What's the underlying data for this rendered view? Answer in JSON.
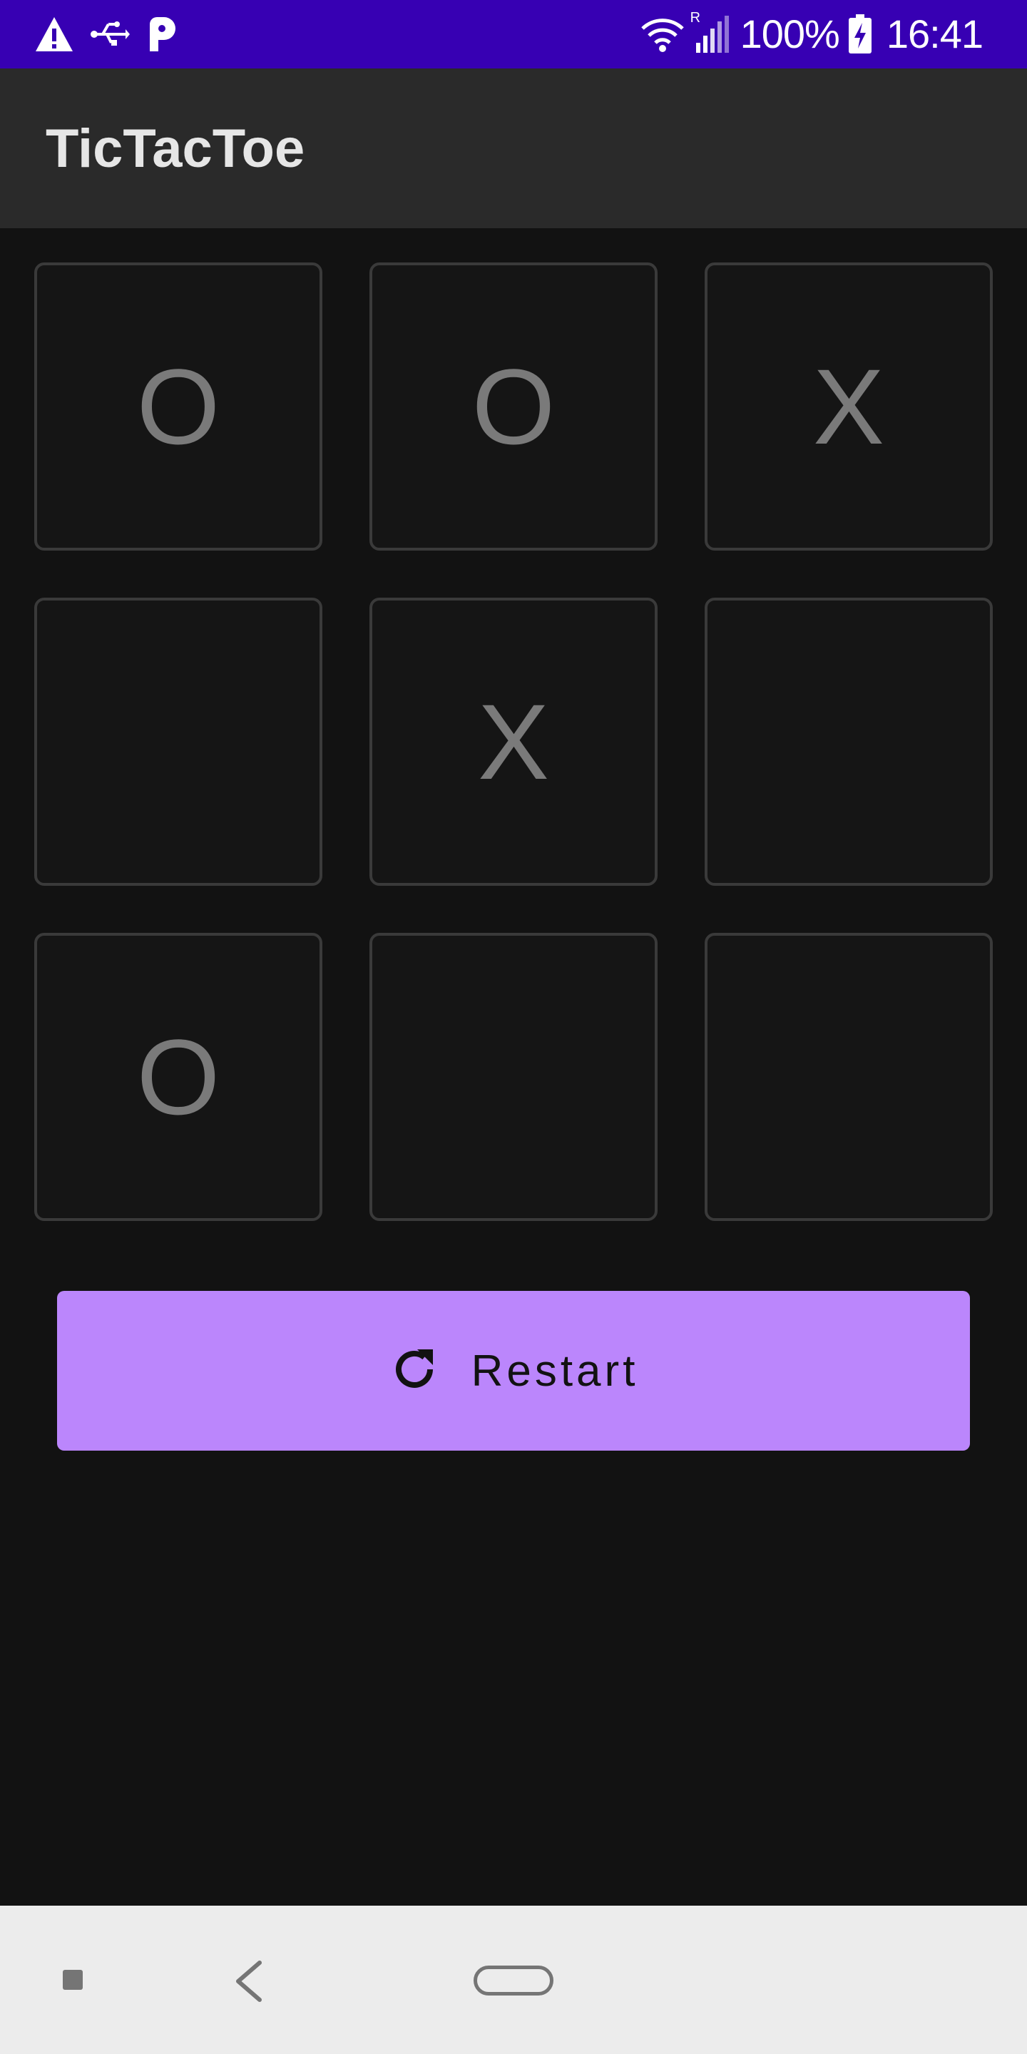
{
  "status_bar": {
    "left_icons": [
      "warning-icon",
      "usb-icon",
      "parking-icon"
    ],
    "right_icons": [
      "wifi-icon",
      "signal-icon",
      "battery-charging-icon"
    ],
    "roaming_indicator": "R",
    "battery_percent": "100%",
    "time": "16:41",
    "background_color": "#3700b3"
  },
  "app_bar": {
    "title": "TicTacToe",
    "background_color": "#2a2a2a"
  },
  "board": {
    "cells": [
      "O",
      "O",
      "X",
      "",
      "X",
      "",
      "O",
      "",
      ""
    ]
  },
  "restart_button": {
    "label": "Restart",
    "icon": "refresh-icon",
    "background_color": "#bb86fc"
  },
  "nav_bar": {
    "icons": [
      "recents-square-icon",
      "back-chevron-icon",
      "home-pill-icon"
    ],
    "background_color": "#ececec"
  }
}
